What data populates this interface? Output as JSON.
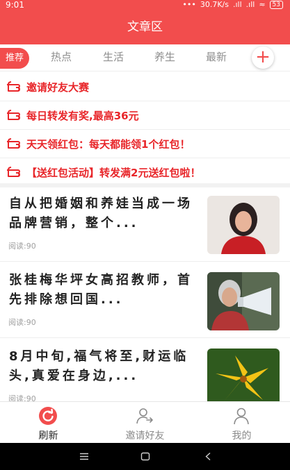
{
  "status": {
    "time": "9:01",
    "network": "30.7K/s",
    "battery": "53"
  },
  "header": {
    "title": "文章区"
  },
  "tabs": [
    {
      "label": "推荐",
      "active": true
    },
    {
      "label": "热点"
    },
    {
      "label": "生活"
    },
    {
      "label": "养生"
    },
    {
      "label": "最新"
    }
  ],
  "notices": [
    {
      "text": "邀请好友大赛"
    },
    {
      "text": "每日转发有奖,最高36元"
    },
    {
      "text": "天天领红包：每天都能领1个红包！"
    },
    {
      "text": "【送红包活动】转发满2元送红包啦！"
    }
  ],
  "articles": [
    {
      "title": "自从把婚姻和养娃当成一场品牌营销，整个...",
      "meta": "阅读:90",
      "thumb": "woman-red-dress-photo"
    },
    {
      "title": "张桂梅华坪女高招教师，首先排除想回国...",
      "meta": "阅读:90",
      "thumb": "woman-megaphone-photo"
    },
    {
      "title": "8月中旬,福气将至,财运临头,真爱在身边,...",
      "meta": "阅读:90",
      "thumb": "yellow-lily-photo"
    }
  ],
  "bottom_nav": [
    {
      "label": "刷新",
      "icon": "refresh-icon",
      "active": true
    },
    {
      "label": "邀请好友",
      "icon": "invite-user-icon"
    },
    {
      "label": "我的",
      "icon": "profile-icon"
    }
  ],
  "colors": {
    "accent": "#f24d4d",
    "notice": "#e8262a"
  }
}
